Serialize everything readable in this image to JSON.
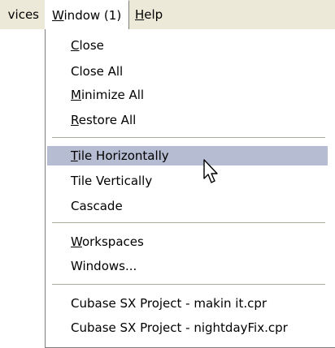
{
  "menubar": {
    "devices_label": "vices",
    "window_label_prefix": "",
    "window_mnemonic": "W",
    "window_label_rest": "indow (1)",
    "help_mnemonic": "H",
    "help_label_rest": "elp"
  },
  "menu": {
    "close": {
      "mn": "C",
      "rest": "lose"
    },
    "close_all": "Close All",
    "minimize_all": {
      "mn": "M",
      "rest": "inimize All"
    },
    "restore_all": {
      "mn": "R",
      "rest": "estore All"
    },
    "tile_horizontally": {
      "mn": "T",
      "rest": "ile Horizontally"
    },
    "tile_vertically": "Tile Vertically",
    "cascade": "Cascade",
    "workspaces": {
      "mn": "W",
      "rest": "orkspaces"
    },
    "windows": "Windows...",
    "project_1": "Cubase SX Project - makin it.cpr",
    "project_2": "Cubase SX Project - nightdayFix.cpr"
  },
  "colors": {
    "menubar_bg": "#ece9d8",
    "highlight": "#b6bdd2",
    "separator": "#aca899"
  },
  "icons": {
    "cursor": "arrow-pointer-icon"
  }
}
